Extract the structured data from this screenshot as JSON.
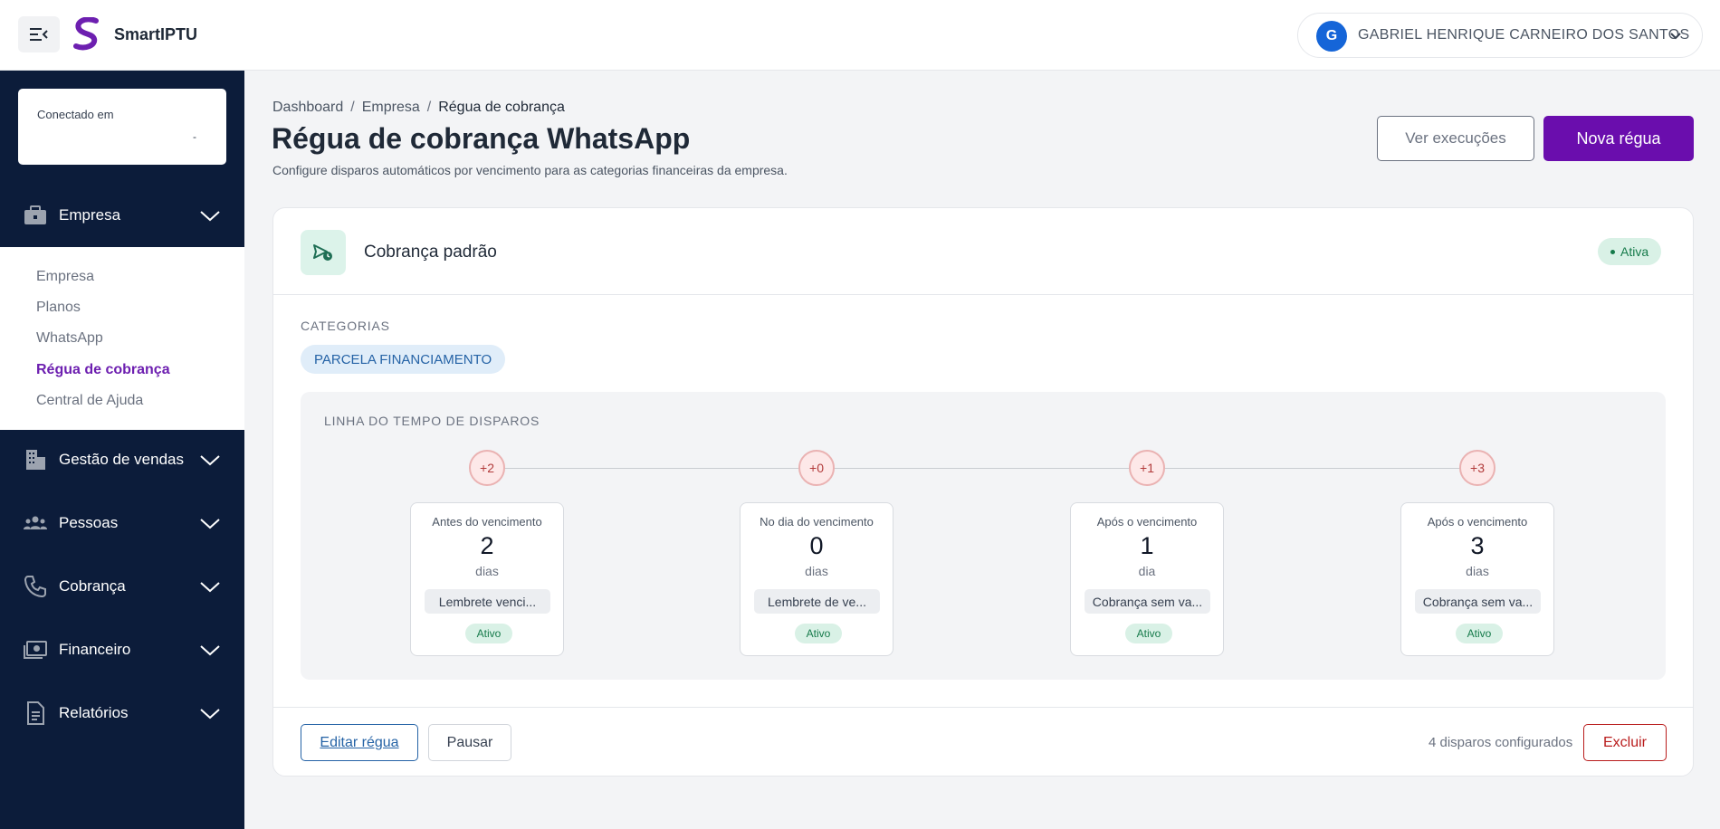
{
  "header": {
    "brand": "SmartIPTU",
    "user_initial": "G",
    "user_name": "GABRIEL HENRIQUE CARNEIRO DOS SANTOS"
  },
  "sidebar": {
    "connected_label": "Conectado em",
    "connected_value": "-",
    "sections": [
      {
        "label": "Empresa",
        "icon": "briefcase-icon",
        "expanded": true
      },
      {
        "label": "Gestão de vendas",
        "icon": "building-icon"
      },
      {
        "label": "Pessoas",
        "icon": "people-icon"
      },
      {
        "label": "Cobrança",
        "icon": "phone-icon"
      },
      {
        "label": "Financeiro",
        "icon": "money-icon"
      },
      {
        "label": "Relatórios",
        "icon": "document-icon"
      }
    ],
    "submenu": [
      {
        "label": "Empresa"
      },
      {
        "label": "Planos"
      },
      {
        "label": "WhatsApp"
      },
      {
        "label": "Régua de cobrança",
        "active": true
      },
      {
        "label": "Central de Ajuda"
      }
    ]
  },
  "breadcrumb": [
    "Dashboard",
    "Empresa",
    "Régua de cobrança"
  ],
  "page": {
    "title": "Régua de cobrança WhatsApp",
    "subtitle": "Configure disparos automáticos por vencimento para as categorias financeiras da empresa.",
    "btn_executions": "Ver execuções",
    "btn_new": "Nova régua"
  },
  "rule": {
    "name": "Cobrança padrão",
    "status": "Ativa",
    "categories_label": "CATEGORIAS",
    "categories": [
      "PARCELA FINANCIAMENTO"
    ],
    "timeline_label": "LINHA DO TEMPO DE DISPAROS",
    "triggers": [
      {
        "offset": "+2",
        "when": "Antes do vencimento",
        "days": "2",
        "unit": "dias",
        "template": "Lembrete venci...",
        "status": "Ativo"
      },
      {
        "offset": "+0",
        "when": "No dia do vencimento",
        "days": "0",
        "unit": "dias",
        "template": "Lembrete de ve...",
        "status": "Ativo"
      },
      {
        "offset": "+1",
        "when": "Após o vencimento",
        "days": "1",
        "unit": "dia",
        "template": "Cobrança sem va...",
        "status": "Ativo"
      },
      {
        "offset": "+3",
        "when": "Após o vencimento",
        "days": "3",
        "unit": "dias",
        "template": "Cobrança sem va...",
        "status": "Ativo"
      }
    ],
    "btn_edit": "Editar régua",
    "btn_pause": "Pausar",
    "summary": "4 disparos configurados",
    "btn_delete": "Excluir"
  },
  "colors": {
    "primary": "#6a0dad",
    "sidebar": "#0c1c3a",
    "success": "#157a4a",
    "danger": "#b91c1c",
    "link": "#2563a6"
  }
}
